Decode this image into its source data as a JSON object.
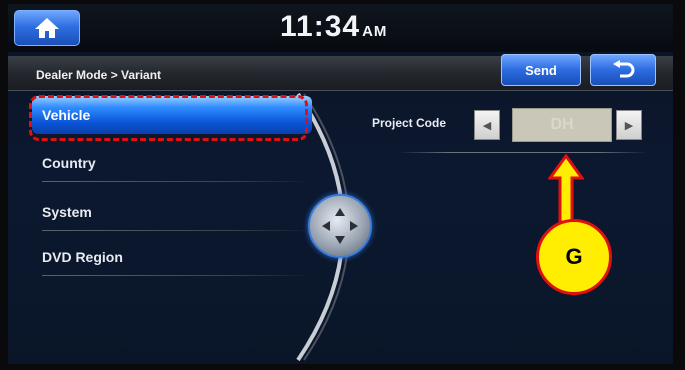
{
  "status_bar": {
    "time": "11:34",
    "ampm": "AM",
    "home_icon": "home-icon"
  },
  "title_bar": {
    "breadcrumb": "Dealer Mode > Variant",
    "send_label": "Send",
    "back_icon": "back-arrow-icon"
  },
  "menu": {
    "items": [
      {
        "label": "Vehicle",
        "selected": true
      },
      {
        "label": "Country",
        "selected": false
      },
      {
        "label": "System",
        "selected": false
      },
      {
        "label": "DVD Region",
        "selected": false
      }
    ]
  },
  "settings": {
    "project_code_label": "Project Code",
    "project_code_value": "DH"
  },
  "annotation": {
    "callout_letter": "G",
    "highlight_color": "#e01010",
    "callout_color": "#ffee00"
  },
  "colors": {
    "accent_blue": "#2f6fe0",
    "selected_item": "#0b55d8"
  }
}
